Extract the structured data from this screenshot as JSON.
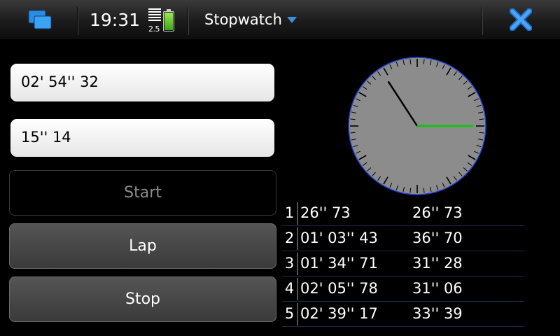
{
  "statusbar": {
    "time": "19:31",
    "signal_label": "2.5",
    "app_title": "Stopwatch",
    "task_switcher_icon": "task-switcher-icon",
    "menu_icon": "dropdown-arrow-icon",
    "close_icon": "close-icon",
    "battery_icon": "battery-icon",
    "accent": "#3e8fe3"
  },
  "stopwatch": {
    "total_time": "02' 54'' 32",
    "lap_time": "15'' 14"
  },
  "buttons": {
    "start_label": "Start",
    "start_enabled": false,
    "lap_label": "Lap",
    "stop_label": "Stop"
  },
  "clock": {
    "face_color": "#8c8c8c",
    "rim_color": "#1f3fd6",
    "minute_hand_color": "#000000",
    "second_hand_color": "#00cc00",
    "hand_minutes": 54.5,
    "hand_seconds": 15
  },
  "laps": [
    {
      "number": "1",
      "total": "26'' 73",
      "split": "26'' 73"
    },
    {
      "number": "2",
      "total": "01' 03'' 43",
      "split": "36'' 70"
    },
    {
      "number": "3",
      "total": "01' 34'' 71",
      "split": "31'' 28"
    },
    {
      "number": "4",
      "total": "02' 05'' 78",
      "split": "31'' 06"
    },
    {
      "number": "5",
      "total": "02' 39'' 17",
      "split": "33'' 39"
    }
  ]
}
